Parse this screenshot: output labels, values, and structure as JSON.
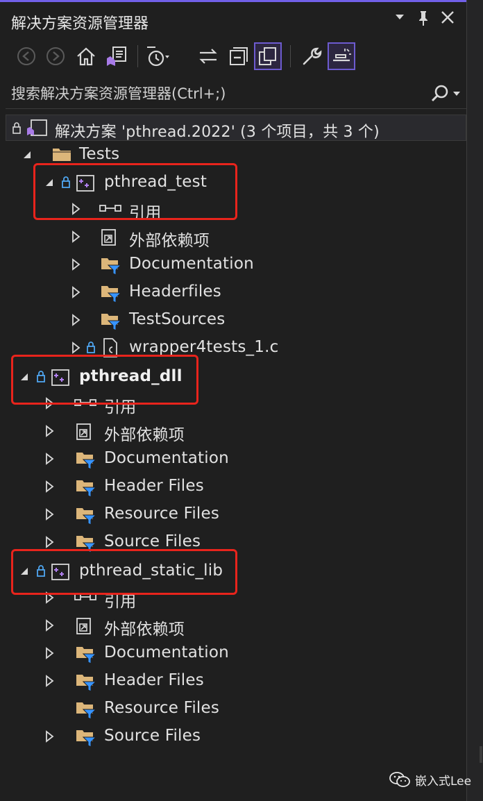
{
  "window": {
    "title": "解决方案资源管理器",
    "controls": {
      "dropdown": "▾",
      "pin": "📌",
      "close": "✕"
    }
  },
  "search": {
    "placeholder": "搜索解决方案资源管理器(Ctrl+;)"
  },
  "tree": {
    "solution_label": "解决方案 'pthread.2022' (3 个项目，共 3 个)",
    "tests_folder": "Tests",
    "project1": {
      "name": "pthread_test",
      "items": [
        "引用",
        "外部依赖项",
        "Documentation",
        "Headerfiles",
        "TestSources",
        "wrapper4tests_1.c"
      ]
    },
    "project2": {
      "name": "pthread_dll",
      "items": [
        "引用",
        "外部依赖项",
        "Documentation",
        "Header Files",
        "Resource Files",
        "Source Files"
      ]
    },
    "project3": {
      "name": "pthread_static_lib",
      "items": [
        "引用",
        "外部依赖项",
        "Documentation",
        "Header Files",
        "Resource Files",
        "Source Files"
      ]
    }
  },
  "watermark": {
    "text": "嵌入式Lee"
  },
  "colors": {
    "accent": "#7160e8",
    "highlight_border": "#e8241c",
    "folder": "#dcb67a",
    "filter": "#3794ff",
    "background": "#1f1f1f"
  }
}
